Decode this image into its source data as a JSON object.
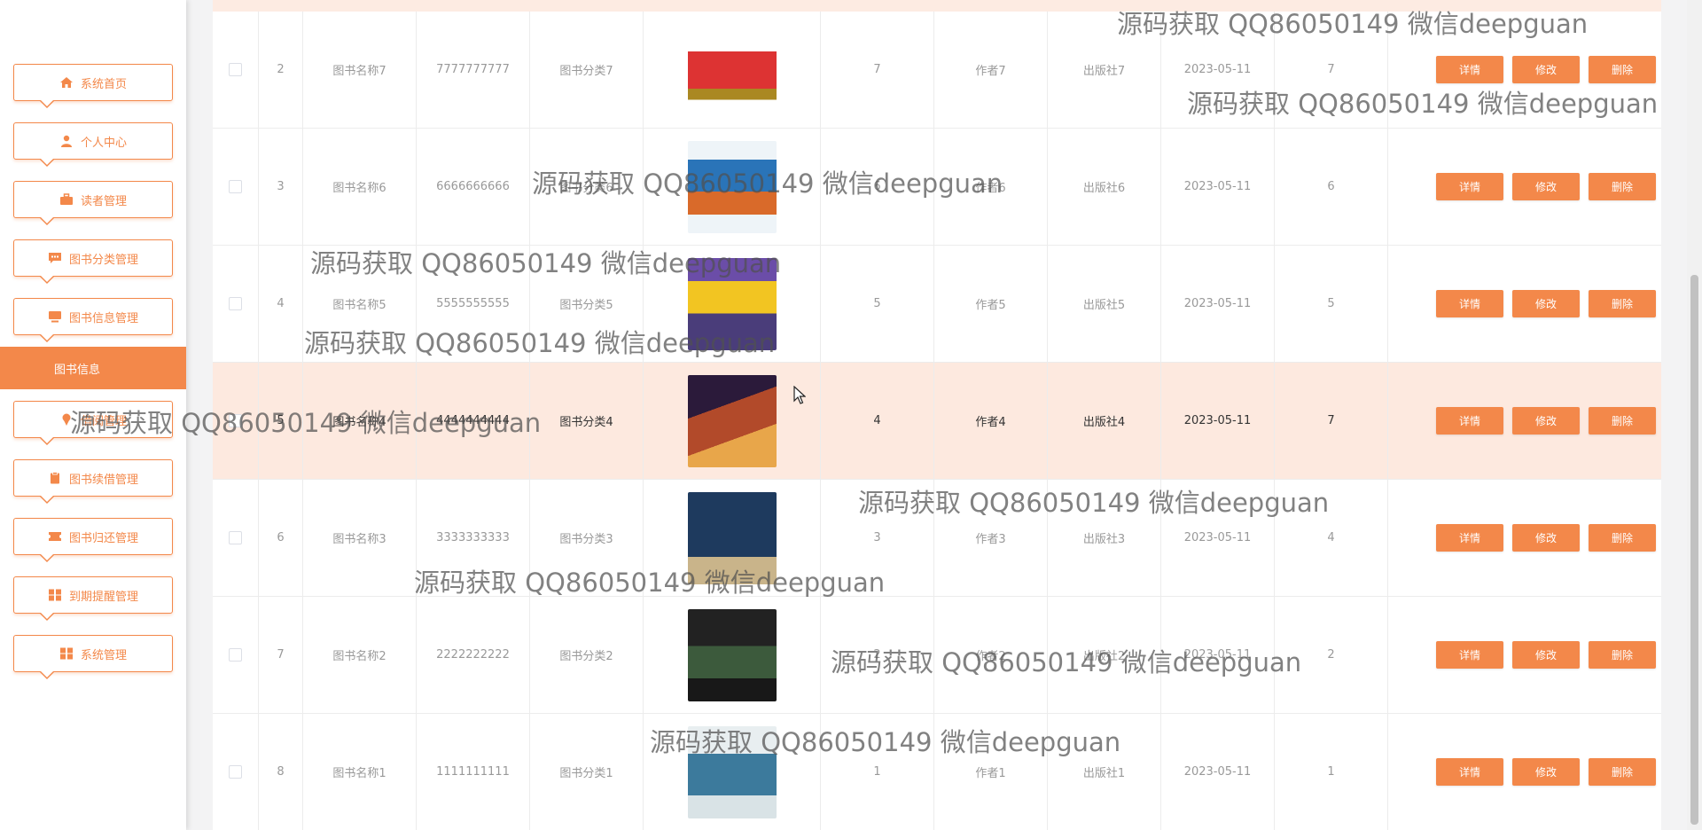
{
  "sidebar": {
    "items": [
      {
        "label": "系统首页",
        "icon": "home-icon"
      },
      {
        "label": "个人中心",
        "icon": "user-icon"
      },
      {
        "label": "读者管理",
        "icon": "briefcase-icon"
      },
      {
        "label": "图书分类管理",
        "icon": "chat-icon"
      },
      {
        "label": "图书信息管理",
        "icon": "monitor-icon"
      },
      {
        "label": "借阅管理",
        "icon": "pin-icon"
      },
      {
        "label": "图书续借管理",
        "icon": "clipboard-icon"
      },
      {
        "label": "图书归还管理",
        "icon": "ticket-icon"
      },
      {
        "label": "到期提醒管理",
        "icon": "grid-icon"
      },
      {
        "label": "系统管理",
        "icon": "grid-icon"
      }
    ],
    "active_sub": "图书信息"
  },
  "table": {
    "rows": [
      {
        "index": "2",
        "name": "图书名称7",
        "isbn": "7777777777",
        "category": "图书分类7",
        "qty": "7",
        "author": "作者7",
        "publisher": "出版社7",
        "date": "2023-05-11",
        "stock": "7"
      },
      {
        "index": "3",
        "name": "图书名称6",
        "isbn": "6666666666",
        "category": "图书分类6",
        "qty": "6",
        "author": "作者6",
        "publisher": "出版社6",
        "date": "2023-05-11",
        "stock": "6"
      },
      {
        "index": "4",
        "name": "图书名称5",
        "isbn": "5555555555",
        "category": "图书分类5",
        "qty": "5",
        "author": "作者5",
        "publisher": "出版社5",
        "date": "2023-05-11",
        "stock": "5"
      },
      {
        "index": "5",
        "name": "图书名称4",
        "isbn": "4444444444",
        "category": "图书分类4",
        "qty": "4",
        "author": "作者4",
        "publisher": "出版社4",
        "date": "2023-05-11",
        "stock": "7"
      },
      {
        "index": "6",
        "name": "图书名称3",
        "isbn": "3333333333",
        "category": "图书分类3",
        "qty": "3",
        "author": "作者3",
        "publisher": "出版社3",
        "date": "2023-05-11",
        "stock": "4"
      },
      {
        "index": "7",
        "name": "图书名称2",
        "isbn": "2222222222",
        "category": "图书分类2",
        "qty": "2",
        "author": "作者2",
        "publisher": "出版社2",
        "date": "2023-05-11",
        "stock": "2"
      },
      {
        "index": "8",
        "name": "图书名称1",
        "isbn": "1111111111",
        "category": "图书分类1",
        "qty": "1",
        "author": "作者1",
        "publisher": "出版社1",
        "date": "2023-05-11",
        "stock": "1"
      }
    ],
    "buttons": {
      "detail": "详情",
      "edit": "修改",
      "delete": "删除"
    }
  },
  "watermark": "源码获取 QQ86050149 微信deepguan",
  "colors": {
    "accent": "#f3884a",
    "highlight_row": "#fde9df"
  }
}
